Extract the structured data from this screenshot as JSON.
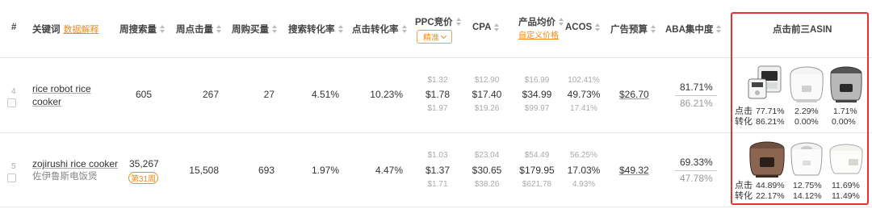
{
  "header": {
    "index": "#",
    "keyword": "关键词",
    "keyword_link": "数据解释",
    "weekly_search": "周搜索量",
    "weekly_clicks": "周点击量",
    "weekly_purchases": "周购买量",
    "search_conv": "搜索转化率",
    "click_conv": "点击转化率",
    "ppc": "PPC竞价",
    "ppc_option": "精准",
    "cpa": "CPA",
    "avg_price": "产品均价",
    "avg_price_link": "自定义价格",
    "acos": "ACOS",
    "ad_budget": "广告预算",
    "aba": "ABA集中度",
    "top3": "点击前三ASIN"
  },
  "rows": [
    {
      "index": "4",
      "keyword_line1": "rice robot rice",
      "keyword_line2": "cooker",
      "keyword_zh": "",
      "badge": "",
      "weekly_search": "605",
      "weekly_clicks": "267",
      "weekly_purchases": "27",
      "search_conv": "4.51%",
      "click_conv": "10.23%",
      "ppc": {
        "low": "$1.32",
        "mid": "$1.78",
        "high": "$1.97"
      },
      "cpa": {
        "low": "$12.90",
        "mid": "$17.40",
        "high": "$19.26"
      },
      "price": {
        "low": "$16.99",
        "mid": "$34.99",
        "high": "$99.97"
      },
      "acos": {
        "low": "102.41%",
        "mid": "49.73%",
        "high": "17.41%"
      },
      "budget": "$26.70",
      "aba": {
        "top": "81.71%",
        "bottom": "86.21%"
      },
      "top3": {
        "label_click": "点击",
        "label_conv": "转化",
        "items": [
          {
            "click": "77.71%",
            "conv": "86.21%"
          },
          {
            "click": "2.29%",
            "conv": "0.00%"
          },
          {
            "click": "1.71%",
            "conv": "0.00%"
          }
        ]
      }
    },
    {
      "index": "5",
      "keyword_line1": "zojirushi rice cooker",
      "keyword_line2": "",
      "keyword_zh": "佐伊鲁斯电饭煲",
      "badge": "第31周",
      "weekly_search": "35,267",
      "weekly_clicks": "15,508",
      "weekly_purchases": "693",
      "search_conv": "1.97%",
      "click_conv": "4.47%",
      "ppc": {
        "low": "$1.03",
        "mid": "$1.37",
        "high": "$1.71"
      },
      "cpa": {
        "low": "$23.04",
        "mid": "$30.65",
        "high": "$38.26"
      },
      "price": {
        "low": "$54.49",
        "mid": "$179.95",
        "high": "$621.78"
      },
      "acos": {
        "low": "56.25%",
        "mid": "17.03%",
        "high": "4.93%"
      },
      "budget": "$49.32",
      "aba": {
        "top": "69.33%",
        "bottom": "47.78%"
      },
      "top3": {
        "label_click": "点击",
        "label_conv": "转化",
        "items": [
          {
            "click": "44.89%",
            "conv": "22.17%"
          },
          {
            "click": "12.75%",
            "conv": "14.12%"
          },
          {
            "click": "11.69%",
            "conv": "11.49%"
          }
        ]
      }
    }
  ],
  "colors": {
    "accent": "#f08c1c",
    "highlight_box": "#e8322f"
  }
}
